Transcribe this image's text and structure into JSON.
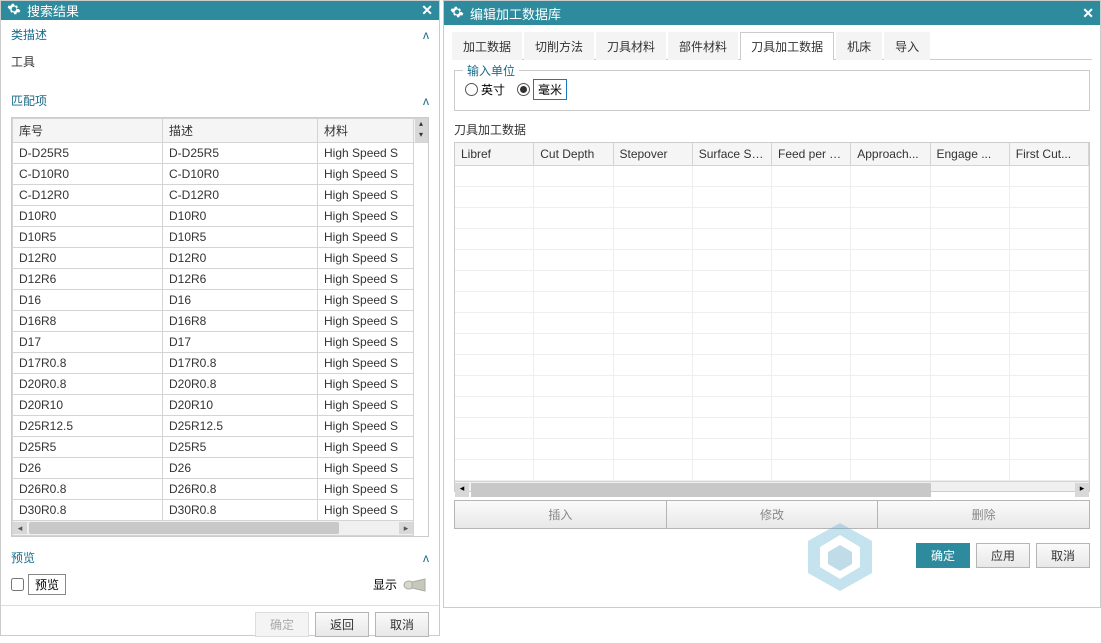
{
  "left": {
    "title": "搜索结果",
    "sections": {
      "classDesc": {
        "header": "类描述",
        "value": "工具"
      },
      "match": {
        "header": "匹配项",
        "columns": [
          "库号",
          "描述",
          "材料"
        ],
        "materialText": "High Speed S",
        "rows": [
          [
            "D-D25R5",
            "D-D25R5"
          ],
          [
            "C-D10R0",
            "C-D10R0"
          ],
          [
            "C-D12R0",
            "C-D12R0"
          ],
          [
            "D10R0",
            "D10R0"
          ],
          [
            "D10R5",
            "D10R5"
          ],
          [
            "D12R0",
            "D12R0"
          ],
          [
            "D12R6",
            "D12R6"
          ],
          [
            "D16",
            "D16"
          ],
          [
            "D16R8",
            "D16R8"
          ],
          [
            "D17",
            "D17"
          ],
          [
            "D17R0.8",
            "D17R0.8"
          ],
          [
            "D20R0.8",
            "D20R0.8"
          ],
          [
            "D20R10",
            "D20R10"
          ],
          [
            "D25R12.5",
            "D25R12.5"
          ],
          [
            "D25R5",
            "D25R5"
          ],
          [
            "D26",
            "D26"
          ],
          [
            "D26R0.8",
            "D26R0.8"
          ],
          [
            "D30R0.8",
            "D30R0.8"
          ]
        ]
      },
      "preview": {
        "header": "预览",
        "checkboxLabel": "预览",
        "showLabel": "显示"
      }
    },
    "buttons": {
      "ok": "确定",
      "back": "返回",
      "cancel": "取消"
    }
  },
  "right": {
    "title": "编辑加工数据库",
    "tabs": [
      "加工数据",
      "切削方法",
      "刀具材料",
      "部件材料",
      "刀具加工数据",
      "机床",
      "导入"
    ],
    "activeTab": 4,
    "unitGroup": {
      "legend": "输入单位",
      "inch": "英寸",
      "mm": "毫米",
      "selected": "mm"
    },
    "dataLabel": "刀具加工数据",
    "gridColumns": [
      "Libref",
      "Cut Depth",
      "Stepover",
      "Surface Spe...",
      "Feed per T...",
      "Approach...",
      "Engage ...",
      "First Cut..."
    ],
    "actionButtons": [
      "插入",
      "修改",
      "删除"
    ],
    "footer": {
      "ok": "确定",
      "apply": "应用",
      "cancel": "取消"
    }
  }
}
